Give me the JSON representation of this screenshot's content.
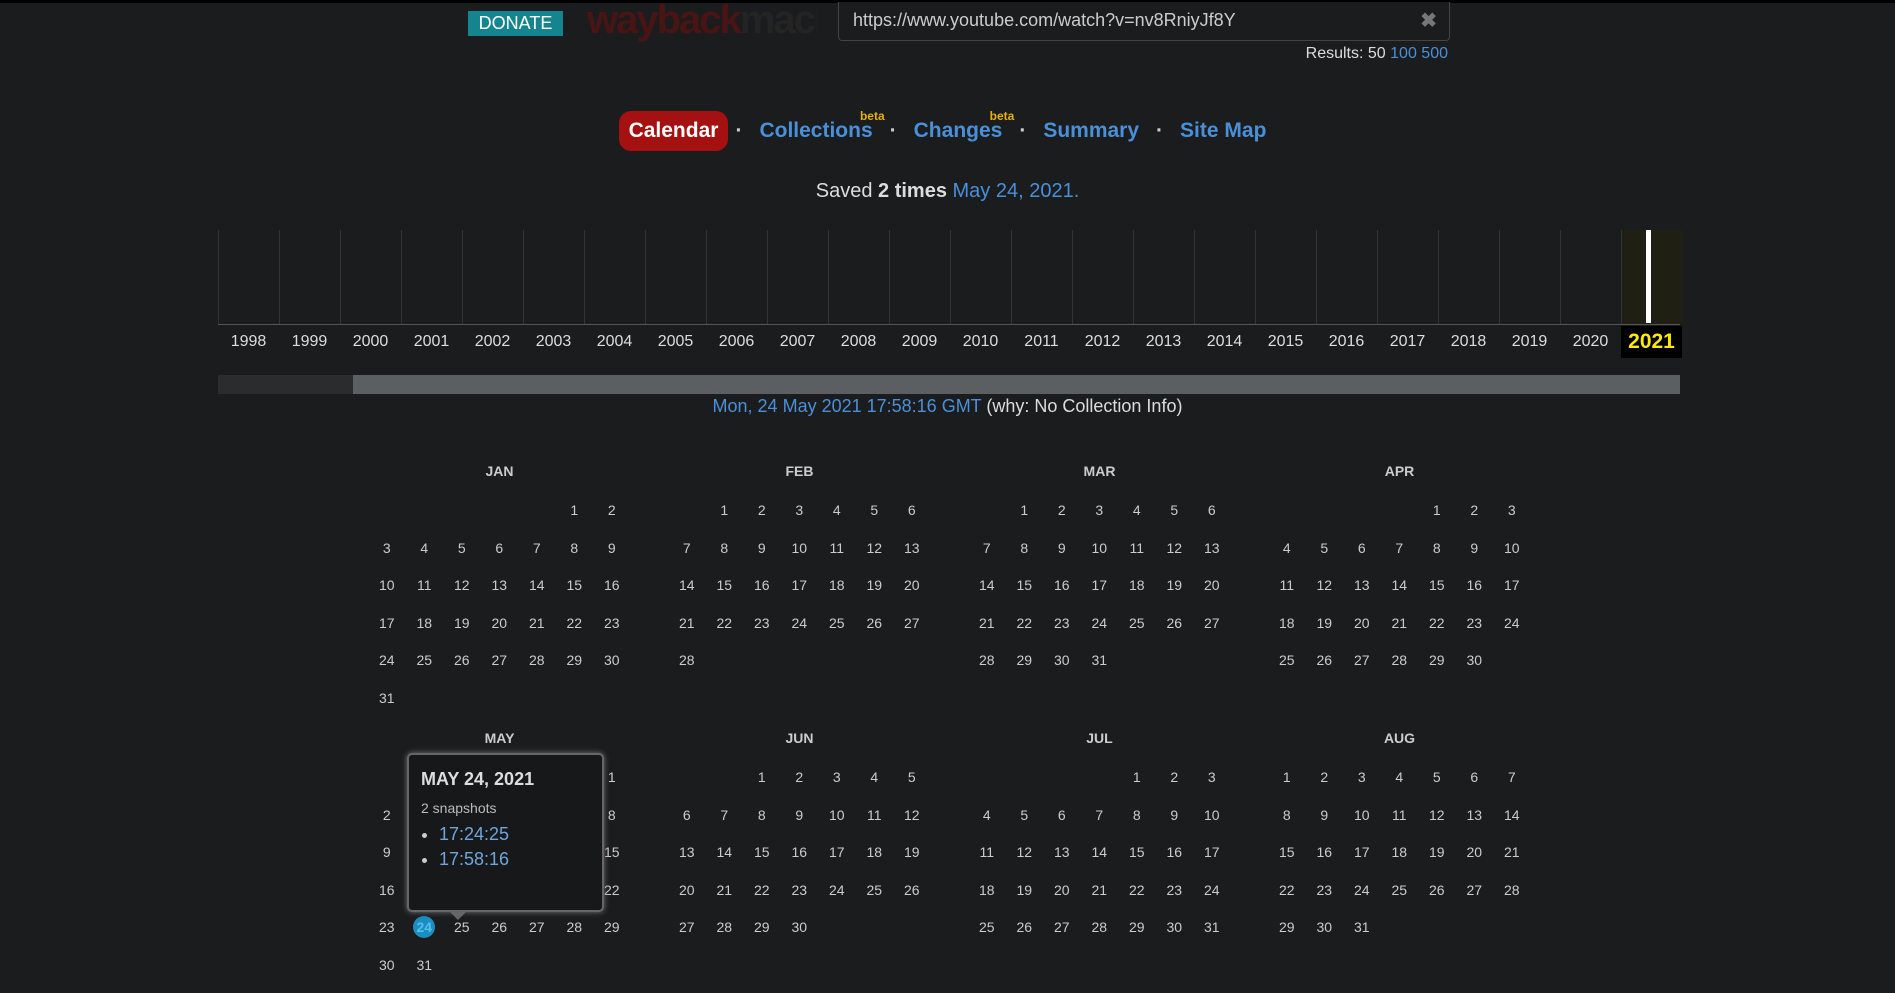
{
  "header": {
    "donate": "DONATE",
    "logo_text_a": "wayback",
    "logo_text_b": "machine",
    "url": "https://www.youtube.com/watch?v=nv8RniyJf8Y",
    "clear_icon": "✖",
    "results_label": "Results: 50",
    "results_links": [
      "100",
      "500"
    ]
  },
  "nav": {
    "items": [
      {
        "label": "Calendar",
        "active": true
      },
      {
        "label": "Collections",
        "beta": "beta"
      },
      {
        "label": "Changes",
        "beta": "beta"
      },
      {
        "label": "Summary"
      },
      {
        "label": "Site Map"
      }
    ],
    "separator": "·"
  },
  "saved": {
    "prefix": "Saved",
    "count": "2 times",
    "date": "May 24, 2021."
  },
  "timeline": {
    "years": [
      "1998",
      "1999",
      "2000",
      "2001",
      "2002",
      "2003",
      "2004",
      "2005",
      "2006",
      "2007",
      "2008",
      "2009",
      "2010",
      "2011",
      "2012",
      "2013",
      "2014",
      "2015",
      "2016",
      "2017",
      "2018",
      "2019",
      "2020",
      "2021"
    ],
    "current": "2021"
  },
  "capture": {
    "timestamp": "Mon, 24 May 2021 17:58:16 GMT",
    "why": "(why: No Collection Info)"
  },
  "calendar": {
    "year": 2021,
    "months": [
      {
        "name": "JAN",
        "start": 5,
        "days": 31
      },
      {
        "name": "FEB",
        "start": 1,
        "days": 28
      },
      {
        "name": "MAR",
        "start": 1,
        "days": 31
      },
      {
        "name": "APR",
        "start": 4,
        "days": 30
      },
      {
        "name": "MAY",
        "start": 6,
        "days": 31,
        "snap_day": 24
      },
      {
        "name": "JUN",
        "start": 2,
        "days": 30
      },
      {
        "name": "JUL",
        "start": 4,
        "days": 31
      },
      {
        "name": "AUG",
        "start": 0,
        "days": 31
      }
    ]
  },
  "tooltip": {
    "title": "MAY 24, 2021",
    "count": "2 snapshots",
    "times": [
      "17:24:25",
      "17:58:16"
    ]
  },
  "colors": {
    "accent": "#4a90d9",
    "active": "#a51010",
    "snap": "#1d8dbf",
    "current_year": "#ffea00"
  }
}
